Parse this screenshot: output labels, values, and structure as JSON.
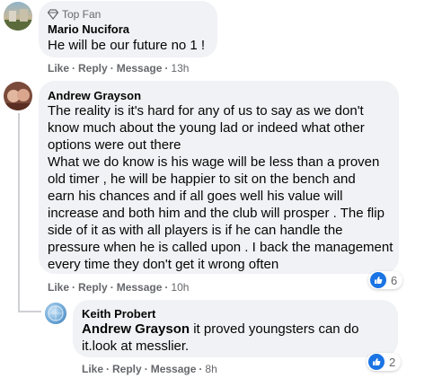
{
  "comments": [
    {
      "badge": "Top Fan",
      "author": "Mario Nucifora",
      "lines": [
        "He will be our future no 1 !"
      ],
      "actions": {
        "like": "Like",
        "reply": "Reply",
        "message": "Message",
        "time": "13h"
      }
    },
    {
      "author": "Andrew Grayson",
      "lines": [
        "The reality is it's hard for any of us to say as we don't",
        "know much about the young lad or indeed what other",
        "options were out there",
        "What we do know is his wage will be less than a proven",
        "old timer , he will be happier to sit on the bench and",
        "earn his chances and if all goes well his value will",
        "increase and both him and the club will prosper . The flip",
        "side of it as with all players is if he can handle the",
        "pressure when he is called upon . I back the management",
        "every time they don't get it wrong often"
      ],
      "actions": {
        "like": "Like",
        "reply": "Reply",
        "message": "Message",
        "time": "10h"
      },
      "reaction_count": "6"
    },
    {
      "author": "Keith Probert",
      "mention": "Andrew Grayson",
      "line1_rest": " it proved youngsters can do",
      "line2": "it.look at messlier.",
      "actions": {
        "like": "Like",
        "reply": "Reply",
        "message": "Message",
        "time": "8h"
      },
      "reaction_count": "2"
    }
  ],
  "colors": {
    "bubble": "#f0f2f5",
    "meta": "#65676b",
    "like": "#1b74e4"
  }
}
